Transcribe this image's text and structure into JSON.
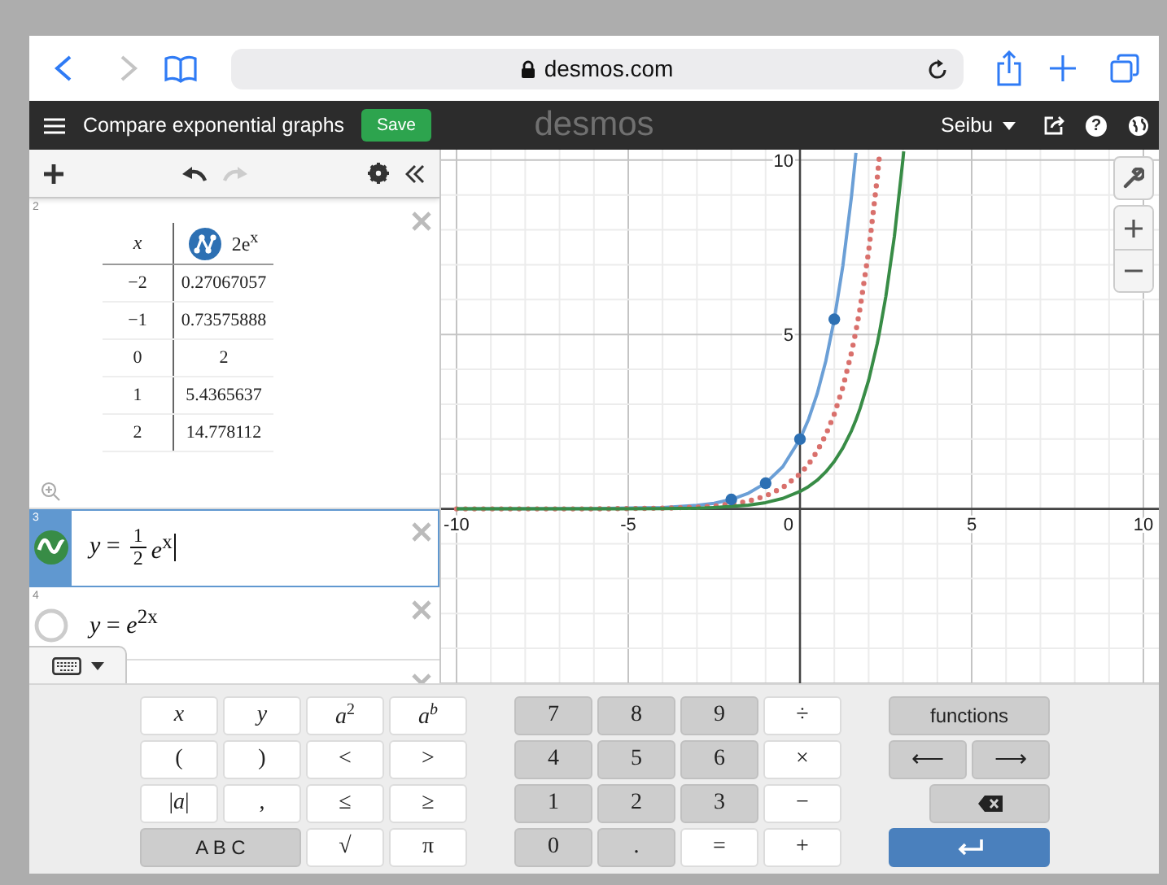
{
  "browser": {
    "url": "desmos.com",
    "back_disabled": false,
    "forward_disabled": true
  },
  "app": {
    "title": "Compare exponential graphs",
    "save": "Save",
    "logo": "desmos",
    "user": "Seibu",
    "help": "?"
  },
  "toolbar": {
    "undo_disabled": false,
    "redo_disabled": true
  },
  "expressions": [
    {
      "index": "2",
      "kind": "table",
      "selected": false,
      "columns": [
        {
          "header": "x",
          "italic": true
        },
        {
          "header": "2e$^{x}$",
          "italic": false,
          "color": "#2d70b3"
        }
      ],
      "rows": [
        [
          "−2",
          "0.27067057"
        ],
        [
          "−1",
          "0.73575888"
        ],
        [
          "0",
          "2"
        ],
        [
          "1",
          "5.4365637"
        ],
        [
          "2",
          "14.778112"
        ]
      ]
    },
    {
      "index": "3",
      "kind": "expression",
      "selected": true,
      "visible": true,
      "color": "#388c46",
      "tokens": [
        {
          "kind": "text",
          "text": "*y* ="
        },
        {
          "kind": "frac",
          "num": "1",
          "den": "2"
        },
        {
          "kind": "text",
          "text": "*e*$^{x}$"
        }
      ]
    },
    {
      "index": "4",
      "kind": "expression",
      "selected": false,
      "visible": false,
      "tokens": [
        {
          "kind": "text",
          "text": "*y* = *e*$^{2x}$"
        }
      ]
    },
    {
      "kind": "blank",
      "selected": false
    }
  ],
  "graph": {
    "chart_data": {
      "type": "line",
      "x": [
        -10,
        -6,
        -4,
        -3,
        -2.5,
        -2,
        -1.5,
        -1,
        -0.5,
        0,
        0.25,
        0.5,
        0.75,
        1,
        1.25,
        1.5,
        1.63,
        1.75,
        2,
        2.25,
        2.32,
        2.5,
        2.75,
        3,
        3.02
      ],
      "series": [
        {
          "color": "#6b9fd6",
          "line_style": "solid",
          "values": [
            0,
            0.01,
            0.04,
            0.1,
            0.16,
            0.27,
            0.45,
            0.74,
            1.21,
            2,
            2.57,
            3.3,
            4.23,
            5.44,
            6.98,
            8.96,
            10.21,
            null,
            null,
            null,
            null,
            null,
            null,
            null,
            null
          ]
        },
        {
          "color": "#d9706c",
          "line_style": "dotted",
          "values": [
            0,
            0,
            0.02,
            0.05,
            0.08,
            0.14,
            0.22,
            0.37,
            0.61,
            1,
            1.28,
            1.65,
            2.12,
            2.72,
            3.49,
            4.48,
            5.1,
            5.75,
            7.39,
            9.49,
            10.18,
            null,
            null,
            null,
            null
          ]
        },
        {
          "color": "#388c46",
          "line_style": "solid",
          "values": [
            0,
            0,
            0.01,
            0.02,
            0.04,
            0.07,
            0.11,
            0.18,
            0.3,
            0.5,
            0.64,
            0.82,
            1.06,
            1.36,
            1.75,
            2.24,
            2.55,
            2.88,
            3.69,
            4.74,
            5.09,
            6.09,
            7.82,
            10.04,
            10.25
          ]
        }
      ],
      "xlim": [
        -10.45,
        10.45
      ],
      "ylim": [
        -5,
        10.3
      ],
      "xticks": [
        -10,
        -5,
        0,
        5,
        10
      ],
      "yticks": [
        5,
        10
      ],
      "grid": true
    }
  },
  "keypad": {
    "groups": [
      {
        "rows": [
          [
            {
              "label": "x",
              "kind": "var"
            },
            {
              "label": "y",
              "kind": "var"
            },
            {
              "label": "*a*$^{2}$",
              "kind": "light"
            },
            {
              "label": "a$^{b}$",
              "kind": "var"
            }
          ],
          [
            {
              "label": "(",
              "kind": "light"
            },
            {
              "label": ")",
              "kind": "light"
            },
            {
              "label": "<",
              "kind": "light"
            },
            {
              "label": ">",
              "kind": "light"
            }
          ],
          [
            {
              "label": "|*a*|",
              "kind": "light"
            },
            {
              "label": ",",
              "kind": "light"
            },
            {
              "label": "≤",
              "kind": "light"
            },
            {
              "label": "≥",
              "kind": "light"
            }
          ],
          [
            {
              "label": "A B C",
              "kind": "mode",
              "colspan": 2
            },
            {
              "label": "√",
              "kind": "light"
            },
            {
              "label": "π",
              "kind": "light"
            }
          ]
        ]
      },
      {
        "rows": [
          [
            {
              "label": "7",
              "kind": "dark"
            },
            {
              "label": "8",
              "kind": "dark"
            },
            {
              "label": "9",
              "kind": "dark"
            },
            {
              "label": "÷",
              "kind": "light"
            }
          ],
          [
            {
              "label": "4",
              "kind": "dark"
            },
            {
              "label": "5",
              "kind": "dark"
            },
            {
              "label": "6",
              "kind": "dark"
            },
            {
              "label": "×",
              "kind": "light"
            }
          ],
          [
            {
              "label": "1",
              "kind": "dark"
            },
            {
              "label": "2",
              "kind": "dark"
            },
            {
              "label": "3",
              "kind": "dark"
            },
            {
              "label": "−",
              "kind": "light"
            }
          ],
          [
            {
              "label": "0",
              "kind": "dark"
            },
            {
              "label": ".",
              "kind": "dark"
            },
            {
              "label": "=",
              "kind": "light"
            },
            {
              "label": "+",
              "kind": "light"
            }
          ]
        ]
      },
      {
        "rows": [
          [
            {
              "label": "functions",
              "kind": "mode",
              "colspan": 2
            }
          ],
          [
            {
              "label": "⟵",
              "kind": "dark"
            },
            {
              "label": "⟶",
              "kind": "dark"
            }
          ],
          [
            {
              "kind": "backspace"
            }
          ],
          [
            {
              "kind": "enter",
              "colspan": 2
            }
          ]
        ]
      }
    ]
  }
}
